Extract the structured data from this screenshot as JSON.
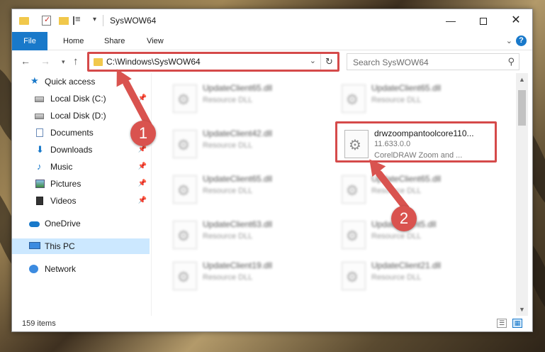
{
  "window": {
    "title": "SysWOW64"
  },
  "ribbon": {
    "tabs": [
      "File",
      "Home",
      "Share",
      "View"
    ]
  },
  "address": {
    "path": "C:\\Windows\\SysWOW64",
    "search_placeholder": "Search SysWOW64"
  },
  "sidebar": {
    "items": [
      {
        "label": "Quick access",
        "icon": "star-icon",
        "pinned": false
      },
      {
        "label": "Local Disk (C:)",
        "icon": "disk-icon",
        "pinned": true
      },
      {
        "label": "Local Disk (D:)",
        "icon": "disk-icon",
        "pinned": false
      },
      {
        "label": "Documents",
        "icon": "document-icon",
        "pinned": true
      },
      {
        "label": "Downloads",
        "icon": "download-icon",
        "pinned": true
      },
      {
        "label": "Music",
        "icon": "music-icon",
        "pinned": true
      },
      {
        "label": "Pictures",
        "icon": "pictures-icon",
        "pinned": true
      },
      {
        "label": "Videos",
        "icon": "video-icon",
        "pinned": true
      },
      {
        "label": "OneDrive",
        "icon": "cloud-icon",
        "pinned": false
      },
      {
        "label": "This PC",
        "icon": "computer-icon",
        "pinned": false,
        "selected": true
      },
      {
        "label": "Network",
        "icon": "network-icon",
        "pinned": false
      }
    ]
  },
  "files": {
    "left_column": [
      {
        "name": "UpdateClient65.dll",
        "type": "Resource DLL"
      },
      {
        "name": "UpdateClient42.dll",
        "type": "Resource DLL"
      },
      {
        "name": "UpdateClient65.dll",
        "type": "Resource DLL"
      },
      {
        "name": "UpdateClient63.dll",
        "type": "Resource DLL"
      },
      {
        "name": "UpdateClient19.dll",
        "type": "Resource DLL"
      }
    ],
    "right_column": [
      {
        "name": "UpdateClient65.dll",
        "type": "Resource DLL"
      },
      {
        "name": "drwzoompantoolcore110...",
        "version": "11.633.0.0",
        "description": "CorelDRAW Zoom and ...",
        "highlighted": true
      },
      {
        "name": "UpdateClient65.dll",
        "type": "Resource DLL"
      },
      {
        "name": "UpdateClient5.dll",
        "type": "Resource DLL"
      },
      {
        "name": "UpdateClient21.dll",
        "type": "Resource DLL"
      }
    ]
  },
  "status": {
    "item_count": "159 items"
  },
  "callouts": {
    "first": "1",
    "second": "2"
  },
  "colors": {
    "accent": "#1979ca",
    "highlight": "#d54a4a",
    "selected_bg": "#cce8ff"
  }
}
